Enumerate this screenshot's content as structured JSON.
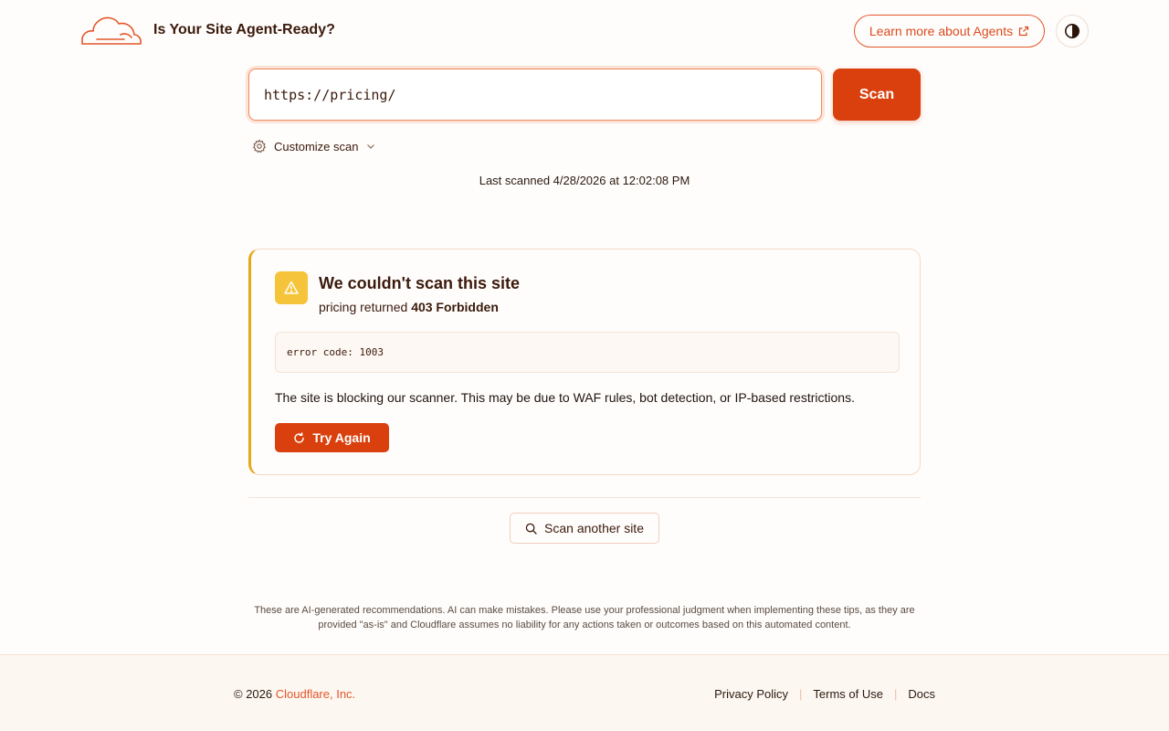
{
  "header": {
    "title": "Is Your Site Agent-Ready?",
    "learn_more_label": "Learn more about Agents"
  },
  "search": {
    "url_value": "https://pricing/",
    "scan_label": "Scan",
    "customize_label": "Customize scan",
    "last_scanned": "Last scanned 4/28/2026 at 12:02:08 PM"
  },
  "error": {
    "title": "We couldn't scan this site",
    "host": "pricing",
    "returned_text": " returned ",
    "status": "403 Forbidden",
    "code": "error code: 1003",
    "description": "The site is blocking our scanner. This may be due to WAF rules, bot detection, or IP-based restrictions.",
    "try_again_label": "Try Again"
  },
  "scan_another_label": "Scan another site",
  "disclaimer": "These are AI-generated recommendations. AI can make mistakes. Please use your professional judgment when implementing these tips, as they are provided \"as-is\" and Cloudflare assumes no liability for any actions taken or outcomes based on this automated content.",
  "footer": {
    "copyright_prefix": "© 2026 ",
    "company": "Cloudflare, Inc.",
    "links": [
      "Privacy Policy",
      "Terms of Use",
      "Docs"
    ],
    "separator": "|"
  },
  "colors": {
    "accent": "#d9400e",
    "warning": "#f5c43a",
    "background": "#fffdfb"
  },
  "icons": {
    "logo": "cloudflare-cloud-icon",
    "external": "external-link-icon",
    "theme": "contrast-icon",
    "settings": "gear-icon",
    "chevron": "chevron-down-icon",
    "warning": "warning-triangle-icon",
    "retry": "refresh-icon",
    "search": "search-icon"
  }
}
